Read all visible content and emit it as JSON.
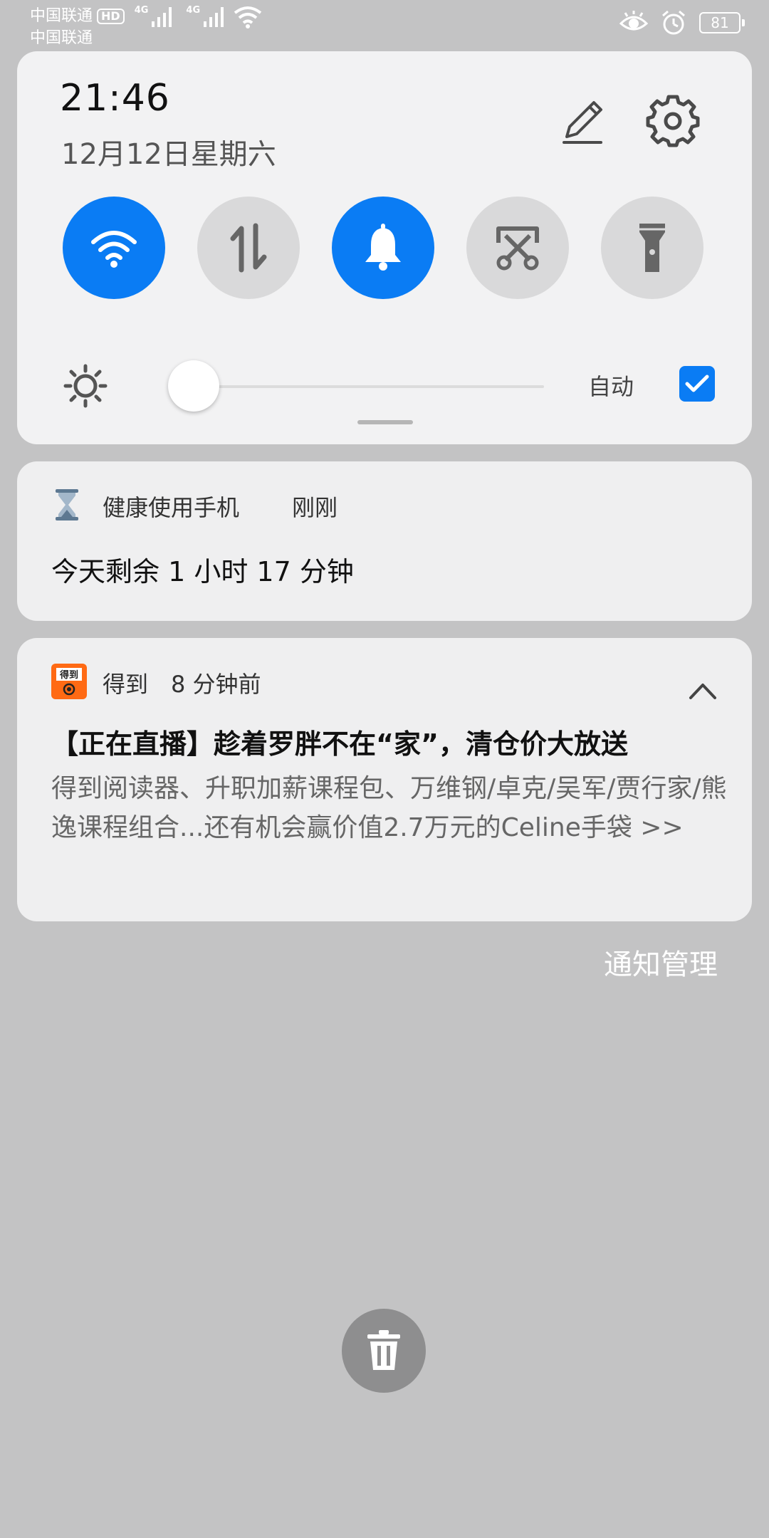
{
  "status_bar": {
    "carrier_1": "中国联通",
    "carrier_2": "中国联通",
    "hd_badge": "HD",
    "net_type_1": "4G",
    "net_type_2": "4G",
    "battery": "81",
    "icons": [
      "eye-comfort-icon",
      "alarm-icon",
      "battery-icon"
    ]
  },
  "quick_settings": {
    "time": "21:46",
    "date": "12月12日星期六",
    "tiles": [
      {
        "name": "wifi",
        "active": true
      },
      {
        "name": "mobile-data",
        "active": false
      },
      {
        "name": "sound",
        "active": true
      },
      {
        "name": "screenshot",
        "active": false
      },
      {
        "name": "flashlight",
        "active": false
      }
    ],
    "brightness_level": 0.0,
    "auto_label": "自动",
    "auto_checked": true,
    "accent_color": "#0A7CF4"
  },
  "notifications": [
    {
      "app": "健康使用手机",
      "time": "刚刚",
      "title": "今天剩余 1 小时 17 分钟"
    },
    {
      "app": "得到",
      "time": "8 分钟前",
      "icon_text": "得到",
      "title": "【正在直播】趁着罗胖不在“家”，清仓价大放送",
      "body": "得到阅读器、升职加薪课程包、万维钢/卓克/吴军/贾行家/熊逸课程组合...还有机会赢价值2.7万元的Celine手袋 >>"
    }
  ],
  "notification_manage": "通知管理"
}
